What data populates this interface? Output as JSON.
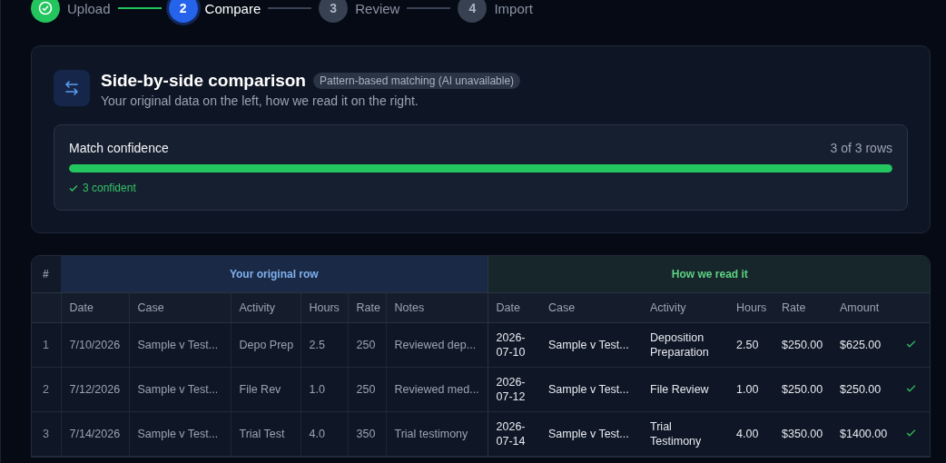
{
  "stepper": [
    {
      "label": "Upload",
      "completed": true,
      "selected": false
    },
    {
      "label": "Compare",
      "number": "2",
      "completed": false,
      "selected": true
    },
    {
      "label": "Review",
      "number": "3",
      "completed": false,
      "selected": false
    },
    {
      "label": "Import",
      "number": "4",
      "completed": false,
      "selected": false
    }
  ],
  "header": {
    "title": "Side-by-side comparison",
    "badge": "Pattern-based matching (AI unavailable)",
    "subtitle": "Your original data on the left, how we read it on the right."
  },
  "confidence": {
    "title": "Match confidence",
    "count": "3 of 3 rows",
    "level": 1,
    "summary": "3 confident"
  },
  "table": {
    "index_heading": "#",
    "original_heading": "Your original row",
    "parsed_heading": "How we read it",
    "original_columns": [
      "Date",
      "Case",
      "Activity",
      "Hours",
      "Rate",
      "Notes"
    ],
    "parsed_columns": [
      "Date",
      "Case",
      "Activity",
      "Hours",
      "Rate",
      "Amount"
    ],
    "rows": [
      {
        "index": "1",
        "original": [
          "7/10/2026",
          "Sample v Test...",
          "Depo Prep",
          "2.5",
          "250",
          "Reviewed dep..."
        ],
        "parsed": [
          "2026-07-10",
          "Sample v Test...",
          "Deposition Preparation",
          "2.50",
          "$250.00",
          "$625.00"
        ],
        "confident": true
      },
      {
        "index": "2",
        "original": [
          "7/12/2026",
          "Sample v Test...",
          "File Rev",
          "1.0",
          "250",
          "Reviewed med..."
        ],
        "parsed": [
          "2026-07-12",
          "Sample v Test...",
          "File Review",
          "1.00",
          "$250.00",
          "$250.00"
        ],
        "confident": true
      },
      {
        "index": "3",
        "original": [
          "7/14/2026",
          "Sample v Test...",
          "Trial Test",
          "4.0",
          "350",
          "Trial testimony"
        ],
        "parsed": [
          "2026-07-14",
          "Sample v Test...",
          "Trial Testimony",
          "4.00",
          "$350.00",
          "$1400.00"
        ],
        "confident": true
      }
    ]
  }
}
